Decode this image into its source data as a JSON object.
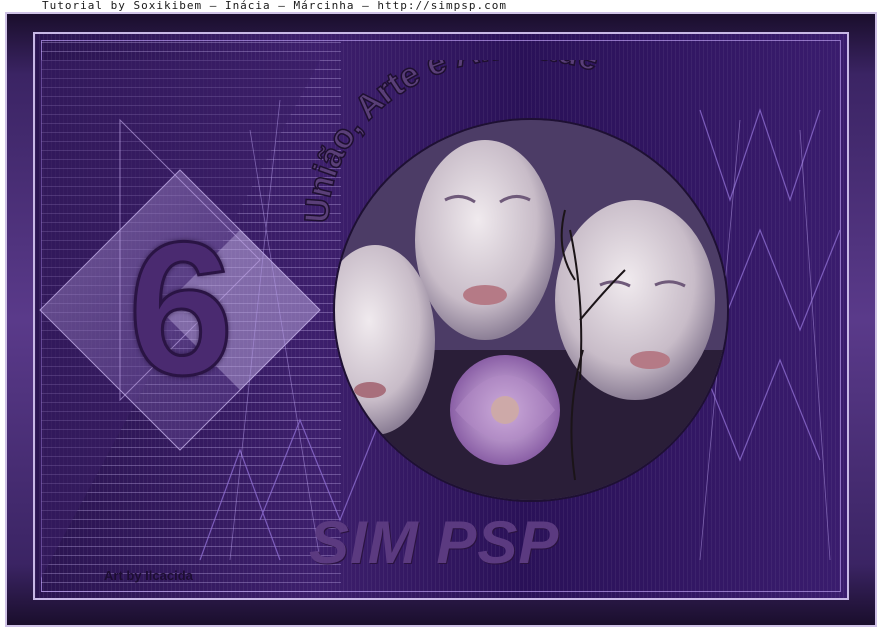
{
  "header": {
    "credit_text": "Tutorial by Soxikibem – Inácia – Márcinha – http://simpsp.com"
  },
  "artwork": {
    "arc_title": "União, Arte e Amizade",
    "number": "6",
    "main_title": "SIM PSP",
    "artist_credit": "Art by Ilcacida"
  },
  "colors": {
    "frame_light": "#cfc2e6",
    "purple_dark": "#2a1450",
    "purple_mid": "#5b3a80",
    "accent_lilac": "#b89ee0"
  }
}
